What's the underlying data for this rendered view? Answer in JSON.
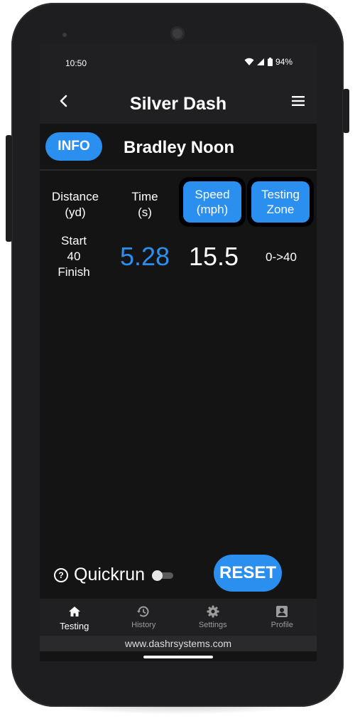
{
  "status_bar": {
    "time": "10:50",
    "battery": "94%"
  },
  "app_bar": {
    "title": "Silver Dash"
  },
  "athlete": {
    "info_label": "INFO",
    "name": "Bradley Noon"
  },
  "table": {
    "distance_header": [
      "Distance",
      "(yd)"
    ],
    "time_header": [
      "Time",
      "(s)"
    ],
    "speed_header": [
      "Speed",
      "(mph)"
    ],
    "zone_header": [
      "Testing",
      "Zone"
    ],
    "distance_values": [
      "Start",
      "40",
      "Finish"
    ],
    "time_value": "5.28",
    "speed_value": "15.5",
    "zone_value": "0->40"
  },
  "controls": {
    "quickrun_label": "Quickrun",
    "quickrun_enabled": false,
    "reset_label": "RESET"
  },
  "bottom_nav": {
    "items": [
      {
        "label": "Testing",
        "icon": "home-icon",
        "active": true
      },
      {
        "label": "History",
        "icon": "history-icon",
        "active": false
      },
      {
        "label": "Settings",
        "icon": "gear-icon",
        "active": false
      },
      {
        "label": "Profile",
        "icon": "profile-icon",
        "active": false
      }
    ]
  },
  "footer": {
    "url": "www.dashrsystems.com"
  },
  "colors": {
    "accent": "#2b8ff0",
    "background": "#141414",
    "bar": "#202022"
  }
}
